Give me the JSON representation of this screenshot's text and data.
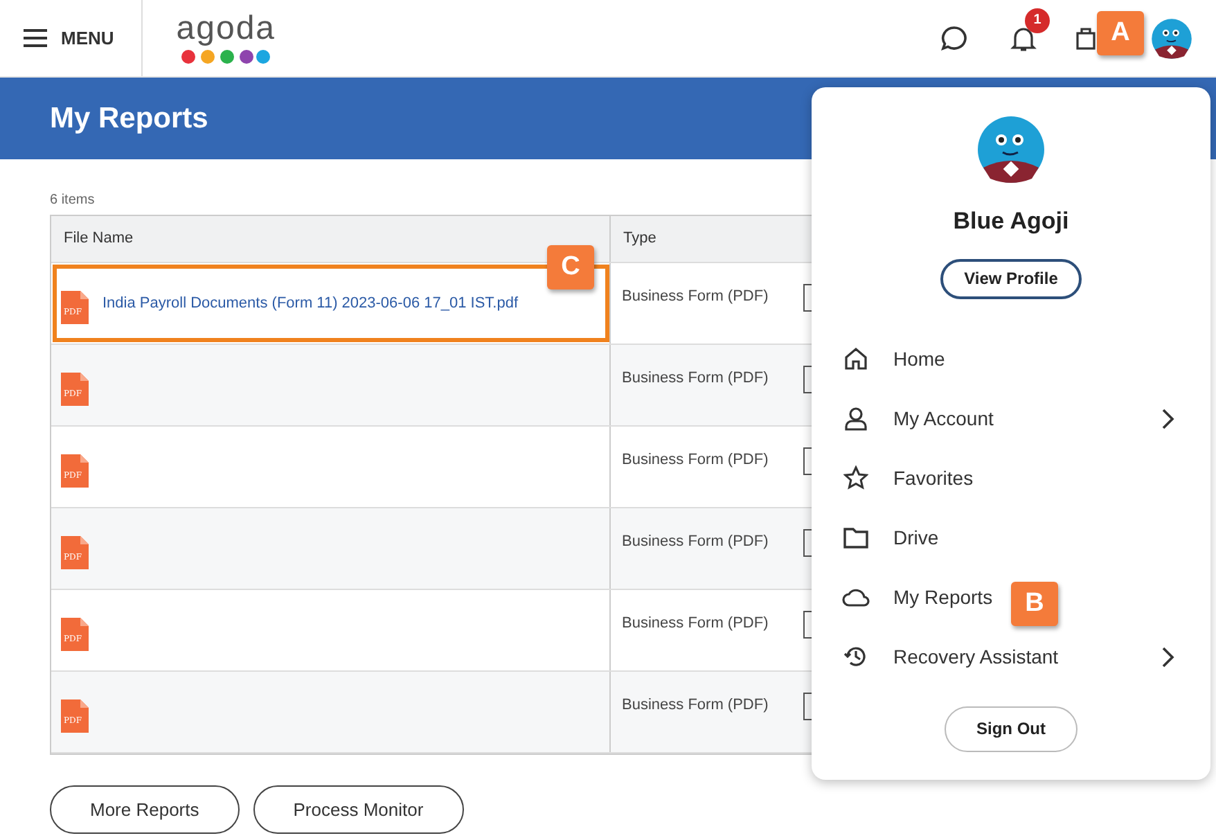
{
  "header": {
    "menu_label": "MENU",
    "logo": "agoda",
    "notification_count": "1"
  },
  "page": {
    "title": "My Reports",
    "item_count": "6 items"
  },
  "table": {
    "columns": [
      "File Name",
      "Type"
    ],
    "rows": [
      {
        "kind": "file",
        "file_name": "India Payroll Documents (Form 11) 2023-06-06 17_01 IST.pdf",
        "type": "Business Form (PDF)",
        "icon_label": "PDF",
        "highlighted": true
      },
      {
        "kind": "redacted",
        "type": "Business Form (PDF)",
        "icon_label": "PDF",
        "highlighted": false
      },
      {
        "kind": "redacted",
        "type": "Business Form (PDF)",
        "icon_label": "PDF",
        "highlighted": false
      },
      {
        "kind": "redacted",
        "type": "Business Form (PDF)",
        "icon_label": "PDF",
        "highlighted": false
      },
      {
        "kind": "redacted",
        "type": "Business Form (PDF)",
        "icon_label": "PDF",
        "highlighted": false
      },
      {
        "kind": "redacted",
        "type": "Business Form (PDF)",
        "icon_label": "PDF",
        "highlighted": false
      }
    ]
  },
  "buttons": [
    "More Reports",
    "Process Monitor"
  ],
  "profile_menu": {
    "name": "Blue Agoji",
    "view_profile": "View Profile",
    "items": [
      {
        "label": "Home",
        "has_submenu": false
      },
      {
        "label": "My Account",
        "has_submenu": true
      },
      {
        "label": "Favorites",
        "has_submenu": false
      },
      {
        "label": "Drive",
        "has_submenu": false
      },
      {
        "label": "My Reports",
        "has_submenu": false
      },
      {
        "label": "Recovery Assistant",
        "has_submenu": true
      }
    ],
    "sign_out": "Sign Out"
  },
  "callouts": [
    {
      "label": "A"
    },
    {
      "label": "B"
    },
    {
      "label": "C"
    }
  ]
}
